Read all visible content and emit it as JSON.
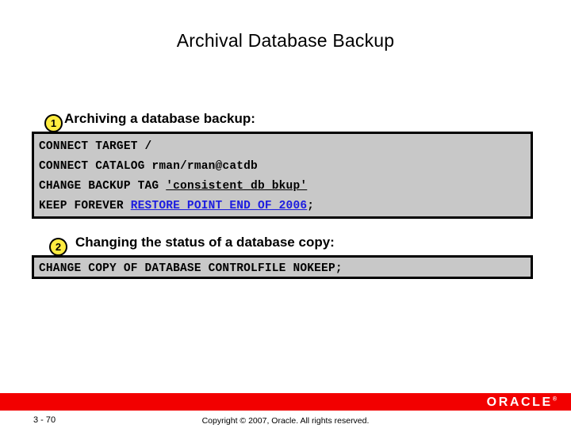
{
  "slide": {
    "title": "Archival Database Backup",
    "steps": [
      {
        "badge": "1",
        "heading": "Archiving a database backup:",
        "code_lines": [
          [
            {
              "text": "CONNECT TARGET /",
              "style": "plain"
            }
          ],
          [
            {
              "text": "CONNECT CATALOG rman/rman@catdb",
              "style": "plain"
            }
          ],
          [
            {
              "text": "CHANGE BACKUP TAG ",
              "style": "plain"
            },
            {
              "text": "'consistent_db_bkup'",
              "style": "underline"
            }
          ],
          [
            {
              "text": "KEEP FOREVER ",
              "style": "plain"
            },
            {
              "text": "RESTORE POINT END_OF_2006",
              "style": "keyword-blue"
            },
            {
              "text": ";",
              "style": "plain"
            }
          ]
        ]
      },
      {
        "badge": "2",
        "heading": "Changing the status of a database copy:",
        "code_lines": [
          [
            {
              "text": "CHANGE COPY OF DATABASE CONTROLFILE NOKEEP;",
              "style": "plain"
            }
          ]
        ]
      }
    ]
  },
  "footer": {
    "logo_text": "ORACLE",
    "logo_tm": "®",
    "page_number": "3 - 70",
    "copyright": "Copyright © 2007, Oracle. All rights reserved."
  },
  "colors": {
    "footer_red": "#f20000",
    "badge_yellow": "#ffec40",
    "code_background": "#c8c8c8",
    "keyword_blue": "#1c1ce0"
  }
}
